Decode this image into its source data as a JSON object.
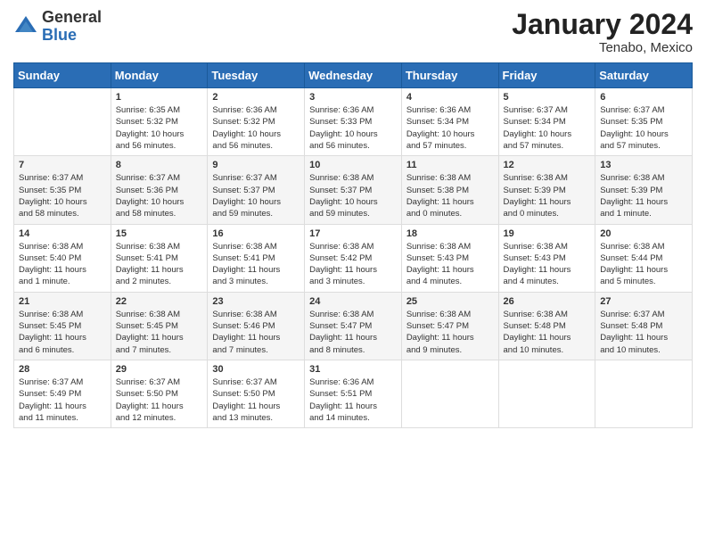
{
  "logo": {
    "general": "General",
    "blue": "Blue"
  },
  "title": "January 2024",
  "location": "Tenabo, Mexico",
  "days_of_week": [
    "Sunday",
    "Monday",
    "Tuesday",
    "Wednesday",
    "Thursday",
    "Friday",
    "Saturday"
  ],
  "weeks": [
    [
      {
        "day": "",
        "info": ""
      },
      {
        "day": "1",
        "info": "Sunrise: 6:35 AM\nSunset: 5:32 PM\nDaylight: 10 hours\nand 56 minutes."
      },
      {
        "day": "2",
        "info": "Sunrise: 6:36 AM\nSunset: 5:32 PM\nDaylight: 10 hours\nand 56 minutes."
      },
      {
        "day": "3",
        "info": "Sunrise: 6:36 AM\nSunset: 5:33 PM\nDaylight: 10 hours\nand 56 minutes."
      },
      {
        "day": "4",
        "info": "Sunrise: 6:36 AM\nSunset: 5:34 PM\nDaylight: 10 hours\nand 57 minutes."
      },
      {
        "day": "5",
        "info": "Sunrise: 6:37 AM\nSunset: 5:34 PM\nDaylight: 10 hours\nand 57 minutes."
      },
      {
        "day": "6",
        "info": "Sunrise: 6:37 AM\nSunset: 5:35 PM\nDaylight: 10 hours\nand 57 minutes."
      }
    ],
    [
      {
        "day": "7",
        "info": "Sunrise: 6:37 AM\nSunset: 5:35 PM\nDaylight: 10 hours\nand 58 minutes."
      },
      {
        "day": "8",
        "info": "Sunrise: 6:37 AM\nSunset: 5:36 PM\nDaylight: 10 hours\nand 58 minutes."
      },
      {
        "day": "9",
        "info": "Sunrise: 6:37 AM\nSunset: 5:37 PM\nDaylight: 10 hours\nand 59 minutes."
      },
      {
        "day": "10",
        "info": "Sunrise: 6:38 AM\nSunset: 5:37 PM\nDaylight: 10 hours\nand 59 minutes."
      },
      {
        "day": "11",
        "info": "Sunrise: 6:38 AM\nSunset: 5:38 PM\nDaylight: 11 hours\nand 0 minutes."
      },
      {
        "day": "12",
        "info": "Sunrise: 6:38 AM\nSunset: 5:39 PM\nDaylight: 11 hours\nand 0 minutes."
      },
      {
        "day": "13",
        "info": "Sunrise: 6:38 AM\nSunset: 5:39 PM\nDaylight: 11 hours\nand 1 minute."
      }
    ],
    [
      {
        "day": "14",
        "info": "Sunrise: 6:38 AM\nSunset: 5:40 PM\nDaylight: 11 hours\nand 1 minute."
      },
      {
        "day": "15",
        "info": "Sunrise: 6:38 AM\nSunset: 5:41 PM\nDaylight: 11 hours\nand 2 minutes."
      },
      {
        "day": "16",
        "info": "Sunrise: 6:38 AM\nSunset: 5:41 PM\nDaylight: 11 hours\nand 3 minutes."
      },
      {
        "day": "17",
        "info": "Sunrise: 6:38 AM\nSunset: 5:42 PM\nDaylight: 11 hours\nand 3 minutes."
      },
      {
        "day": "18",
        "info": "Sunrise: 6:38 AM\nSunset: 5:43 PM\nDaylight: 11 hours\nand 4 minutes."
      },
      {
        "day": "19",
        "info": "Sunrise: 6:38 AM\nSunset: 5:43 PM\nDaylight: 11 hours\nand 4 minutes."
      },
      {
        "day": "20",
        "info": "Sunrise: 6:38 AM\nSunset: 5:44 PM\nDaylight: 11 hours\nand 5 minutes."
      }
    ],
    [
      {
        "day": "21",
        "info": "Sunrise: 6:38 AM\nSunset: 5:45 PM\nDaylight: 11 hours\nand 6 minutes."
      },
      {
        "day": "22",
        "info": "Sunrise: 6:38 AM\nSunset: 5:45 PM\nDaylight: 11 hours\nand 7 minutes."
      },
      {
        "day": "23",
        "info": "Sunrise: 6:38 AM\nSunset: 5:46 PM\nDaylight: 11 hours\nand 7 minutes."
      },
      {
        "day": "24",
        "info": "Sunrise: 6:38 AM\nSunset: 5:47 PM\nDaylight: 11 hours\nand 8 minutes."
      },
      {
        "day": "25",
        "info": "Sunrise: 6:38 AM\nSunset: 5:47 PM\nDaylight: 11 hours\nand 9 minutes."
      },
      {
        "day": "26",
        "info": "Sunrise: 6:38 AM\nSunset: 5:48 PM\nDaylight: 11 hours\nand 10 minutes."
      },
      {
        "day": "27",
        "info": "Sunrise: 6:37 AM\nSunset: 5:48 PM\nDaylight: 11 hours\nand 10 minutes."
      }
    ],
    [
      {
        "day": "28",
        "info": "Sunrise: 6:37 AM\nSunset: 5:49 PM\nDaylight: 11 hours\nand 11 minutes."
      },
      {
        "day": "29",
        "info": "Sunrise: 6:37 AM\nSunset: 5:50 PM\nDaylight: 11 hours\nand 12 minutes."
      },
      {
        "day": "30",
        "info": "Sunrise: 6:37 AM\nSunset: 5:50 PM\nDaylight: 11 hours\nand 13 minutes."
      },
      {
        "day": "31",
        "info": "Sunrise: 6:36 AM\nSunset: 5:51 PM\nDaylight: 11 hours\nand 14 minutes."
      },
      {
        "day": "",
        "info": ""
      },
      {
        "day": "",
        "info": ""
      },
      {
        "day": "",
        "info": ""
      }
    ]
  ]
}
